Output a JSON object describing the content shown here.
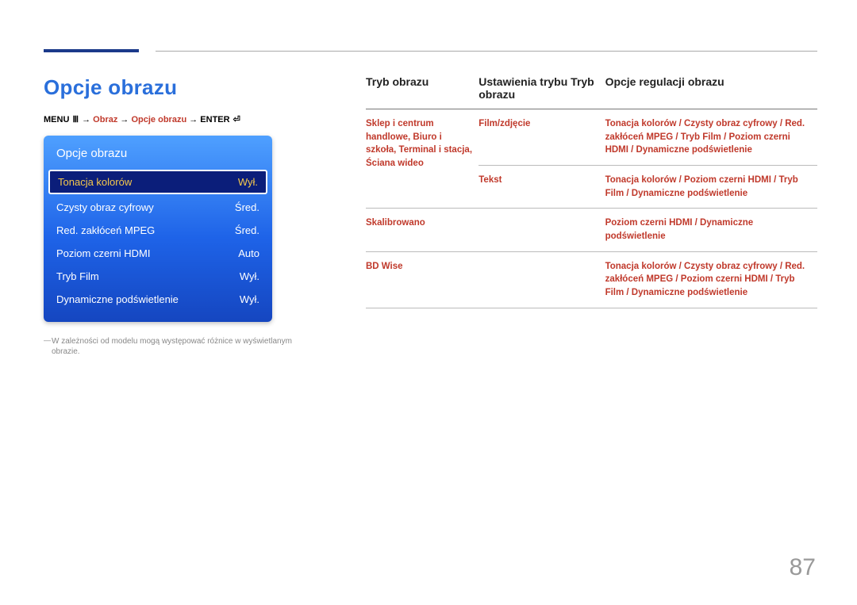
{
  "page_number": "87",
  "heading": "Opcje obrazu",
  "breadcrumb": {
    "prefix": "MENU ",
    "seg1": "Obraz",
    "seg2": "Opcje obrazu",
    "suffix": "ENTER "
  },
  "osd": {
    "title": "Opcje obrazu",
    "rows": [
      {
        "label": "Tonacja kolorów",
        "value": "Wył.",
        "selected": true
      },
      {
        "label": "Czysty obraz cyfrowy",
        "value": "Śred.",
        "selected": false
      },
      {
        "label": "Red. zakłóceń MPEG",
        "value": "Śred.",
        "selected": false
      },
      {
        "label": "Poziom czerni HDMI",
        "value": "Auto",
        "selected": false
      },
      {
        "label": "Tryb Film",
        "value": "Wył.",
        "selected": false
      },
      {
        "label": "Dynamiczne podświetlenie",
        "value": "Wył.",
        "selected": false
      }
    ]
  },
  "footnote": "W zależności od modelu mogą występować różnice w wyświetlanym obrazie.",
  "table": {
    "headers": [
      "Tryb obrazu",
      "Ustawienia trybu Tryb obrazu",
      "Opcje regulacji obrazu"
    ],
    "rows": [
      {
        "c1": "Sklep i centrum handlowe, Biuro i szkoła, Terminal i stacja, Ściana wideo",
        "c2": "Film/zdjęcie",
        "c3": "Tonacja kolorów / Czysty obraz cyfrowy / Red. zakłóceń MPEG / Tryb Film / Poziom czerni HDMI / Dynamiczne podświetlenie"
      },
      {
        "c1": "",
        "c2": "Tekst",
        "c3": "Tonacja kolorów / Poziom czerni HDMI / Tryb Film / Dynamiczne podświetlenie"
      },
      {
        "c1": "Skalibrowano",
        "c2": "",
        "c3": "Poziom czerni HDMI / Dynamiczne podświetlenie"
      },
      {
        "c1": "BD Wise",
        "c2": "",
        "c3": "Tonacja kolorów / Czysty obraz cyfrowy / Red. zakłóceń MPEG / Poziom czerni HDMI / Tryb Film / Dynamiczne podświetlenie"
      }
    ]
  }
}
